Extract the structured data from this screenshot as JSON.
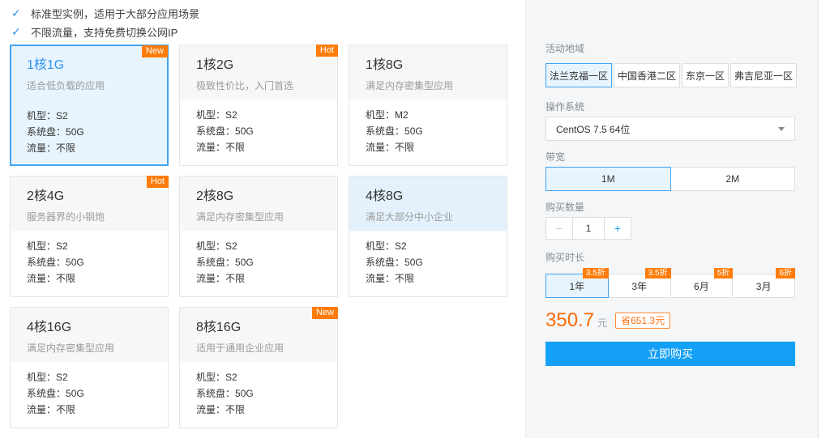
{
  "icons": {
    "check": "✓"
  },
  "features": [
    "标准型实例，适用于大部分应用场景",
    "不限流量，支持免费切换公网IP"
  ],
  "spec_labels": {
    "model": "机型：",
    "disk": "系统盘：",
    "traffic": "流量："
  },
  "plans": [
    {
      "title": "1核1G",
      "desc": "适合低负载的应用",
      "badge": "New",
      "model": "S2",
      "disk": "50G",
      "traffic": "不限"
    },
    {
      "title": "1核2G",
      "desc": "极致性价比，入门首选",
      "badge": "Hot",
      "model": "S2",
      "disk": "50G",
      "traffic": "不限"
    },
    {
      "title": "1核8G",
      "desc": "满足内存密集型应用",
      "badge": "",
      "model": "M2",
      "disk": "50G",
      "traffic": "不限"
    },
    {
      "title": "2核4G",
      "desc": "服务器界的小钢炮",
      "badge": "Hot",
      "model": "S2",
      "disk": "50G",
      "traffic": "不限"
    },
    {
      "title": "2核8G",
      "desc": "满足内存密集型应用",
      "badge": "",
      "model": "S2",
      "disk": "50G",
      "traffic": "不限"
    },
    {
      "title": "4核8G",
      "desc": "满足大部分中小企业",
      "badge": "",
      "model": "S2",
      "disk": "50G",
      "traffic": "不限"
    },
    {
      "title": "4核16G",
      "desc": "满足内存密集型应用",
      "badge": "",
      "model": "S2",
      "disk": "50G",
      "traffic": "不限"
    },
    {
      "title": "8核16G",
      "desc": "适用于通用企业应用",
      "badge": "New",
      "model": "S2",
      "disk": "50G",
      "traffic": "不限"
    }
  ],
  "panel": {
    "region": {
      "label": "活动地域",
      "options": [
        "法兰克福一区",
        "中国香港二区",
        "东京一区",
        "弗吉尼亚一区"
      ],
      "selected_index": 0
    },
    "os": {
      "label": "操作系统",
      "value": "CentOS 7.5 64位"
    },
    "bandwidth": {
      "label": "带宽",
      "options": [
        "1M",
        "2M"
      ],
      "selected_index": 0
    },
    "quantity": {
      "label": "购买数量",
      "minus": "−",
      "value": "1",
      "plus": "+"
    },
    "duration": {
      "label": "购买时长",
      "options": [
        {
          "label": "1年",
          "badge": "3.5折"
        },
        {
          "label": "3年",
          "badge": "3.5折"
        },
        {
          "label": "6月",
          "badge": "5折"
        },
        {
          "label": "3月",
          "badge": "6折"
        }
      ],
      "selected_index": 0
    },
    "price": {
      "amount": "350.7",
      "unit": "元",
      "savings": "省651.3元"
    },
    "buy_label": "立即购买"
  },
  "colors": {
    "accent_blue": "#14a0f6",
    "selected_border": "#41a3f1",
    "selected_bg": "#e8f4fd",
    "badge_orange": "#ff7c0a",
    "price_orange": "#ff6a00"
  }
}
